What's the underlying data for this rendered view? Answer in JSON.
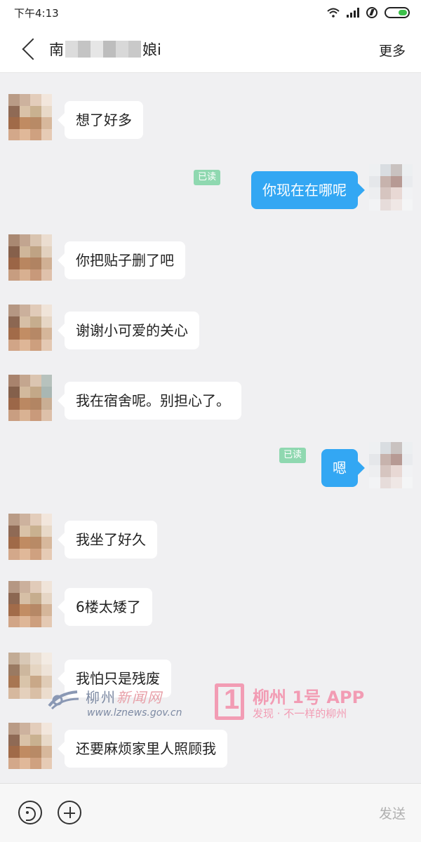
{
  "status_bar": {
    "time": "下午4:13"
  },
  "header": {
    "title_start": "南",
    "title_end": "娘i",
    "more_label": "更多"
  },
  "messages": [
    {
      "side": "left",
      "text": "想了好多"
    },
    {
      "side": "right",
      "text": "你现在在哪呢",
      "read_label": "已读"
    },
    {
      "side": "left",
      "text": "你把贴子删了吧"
    },
    {
      "side": "left",
      "text": "谢谢小可爱的关心"
    },
    {
      "side": "left",
      "text": "我在宿舍呢。别担心了。"
    },
    {
      "side": "right",
      "text": "嗯",
      "read_label": "已读"
    },
    {
      "side": "left",
      "text": "我坐了好久"
    },
    {
      "side": "left",
      "text": "6楼太矮了"
    },
    {
      "side": "left",
      "text": "我怕只是残废"
    },
    {
      "side": "left",
      "text": "还要麻烦家里人照顾我"
    }
  ],
  "watermark": {
    "site_name_part1": "柳州",
    "site_name_part2": "新闻网",
    "url": "www.lznews.gov.cn",
    "app_name": "柳州 1号 APP",
    "slogan": "发现 · 不一样的柳州"
  },
  "input_bar": {
    "send_label": "发送"
  },
  "colors": {
    "accent_blue": "#33a7f3",
    "read_badge": "#8fd8b0",
    "battery_green": "#3cc04a",
    "watermark_pink": "#f29cb4"
  },
  "icons": [
    "back-chevron-icon",
    "wifi-icon",
    "signal-icon",
    "charging-icon",
    "battery-icon",
    "voice-icon",
    "plus-icon"
  ]
}
